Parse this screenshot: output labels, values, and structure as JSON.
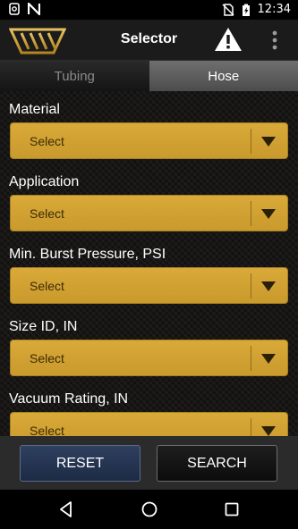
{
  "status_bar": {
    "time": "12:34",
    "icons": [
      "sync-icon",
      "no-signal-icon",
      "sim-off-icon",
      "battery-charging-icon"
    ]
  },
  "app_bar": {
    "title": "Selector",
    "logo": "company-logo",
    "actions": [
      "warning-icon",
      "overflow-menu-icon"
    ]
  },
  "tabs": [
    {
      "label": "Tubing",
      "active": false
    },
    {
      "label": "Hose",
      "active": true
    }
  ],
  "form": {
    "fields": [
      {
        "label": "Material",
        "value": "Select"
      },
      {
        "label": "Application",
        "value": "Select"
      },
      {
        "label": "Min. Burst Pressure, PSI",
        "value": "Select"
      },
      {
        "label": "Size ID, IN",
        "value": "Select"
      },
      {
        "label": "Vacuum Rating, IN",
        "value": "Select"
      }
    ]
  },
  "actions": {
    "reset_label": "RESET",
    "search_label": "SEARCH"
  },
  "nav_bar": {
    "icons": [
      "back-icon",
      "home-icon",
      "recents-icon"
    ]
  },
  "colors": {
    "select_gold": "#d4a334",
    "reset_blue": "#253453",
    "active_tab": "#5e5e5e"
  }
}
